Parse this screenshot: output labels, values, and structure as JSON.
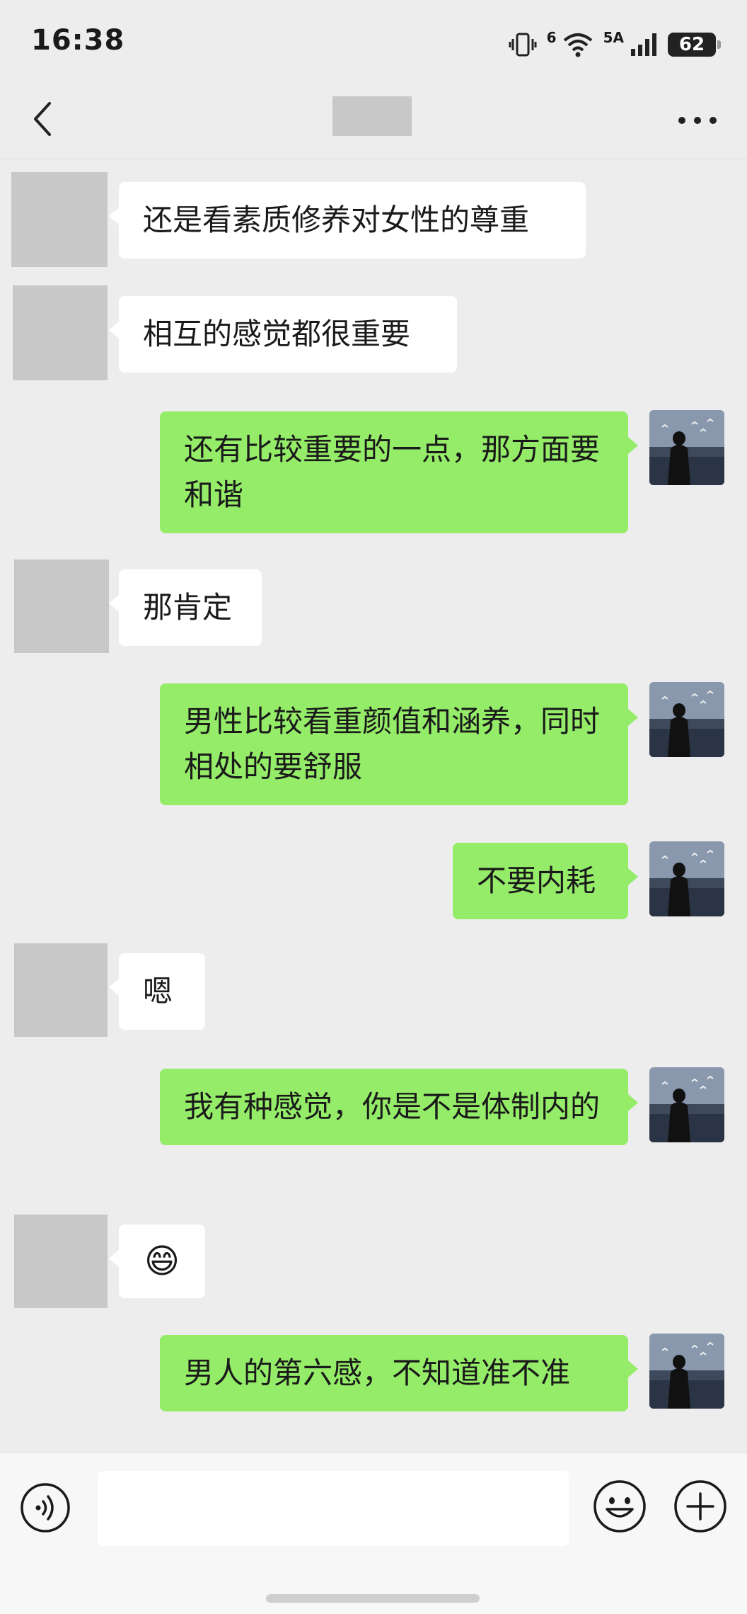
{
  "status_bar": {
    "time": "16:38",
    "network_generation": "6",
    "signal_label": "5A",
    "battery_level": "62"
  },
  "messages": [
    {
      "side": "left",
      "text": "还是看素质修养对女性的尊重"
    },
    {
      "side": "left",
      "text": "相互的感觉都很重要"
    },
    {
      "side": "right",
      "text": "还有比较重要的一点，那方面要和谐"
    },
    {
      "side": "left",
      "text": "那肯定"
    },
    {
      "side": "right",
      "text": "男性比较看重颜值和涵养，同时相处的要舒服"
    },
    {
      "side": "right",
      "text": "不要内耗"
    },
    {
      "side": "left",
      "text": "嗯"
    },
    {
      "side": "right",
      "text": "我有种感觉，你是不是体制内的"
    },
    {
      "side": "left",
      "text": "😄"
    },
    {
      "side": "right",
      "text": "男人的第六感，不知道准不准"
    }
  ],
  "colors": {
    "background": "#ededed",
    "bubble_self": "#95ec69",
    "bubble_other": "#ffffff",
    "blurred_placeholder": "#c8c8c8"
  },
  "icons": {
    "back": "chevron-left-icon",
    "more": "more-dots-icon",
    "voice": "voice-icon",
    "emoji": "emoji-icon",
    "plus": "plus-icon",
    "vibrate": "vibrate-icon",
    "wifi": "wifi-icon",
    "signal": "signal-bars-icon",
    "battery": "battery-icon"
  }
}
